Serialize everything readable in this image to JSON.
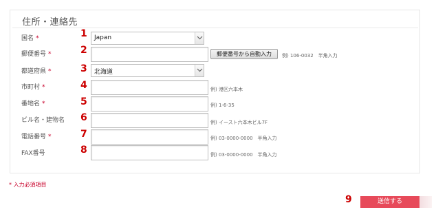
{
  "section_title": "住所・連絡先",
  "required_mark": "*",
  "fields": [
    {
      "label": "国名",
      "required": true,
      "num": "1"
    },
    {
      "label": "郵便番号",
      "required": true,
      "num": "2"
    },
    {
      "label": "都道府県",
      "required": true,
      "num": "3"
    },
    {
      "label": "市町村",
      "required": true,
      "num": "4"
    },
    {
      "label": "番地名",
      "required": true,
      "num": "5"
    },
    {
      "label": "ビル名・建物名",
      "required": false,
      "num": "6"
    },
    {
      "label": "電話番号",
      "required": true,
      "num": "7"
    },
    {
      "label": "FAX番号",
      "required": false,
      "num": "8"
    }
  ],
  "country_select": {
    "value": "Japan"
  },
  "prefecture_select": {
    "value": "北海道"
  },
  "zip_button": "郵便番号から自動入力",
  "hints": {
    "zip": "例) 106-0032　半角入力",
    "city": "例) 港区六本木",
    "address": "例) 1-6-35",
    "building": "例) イースト六本木ビル7F",
    "phone": "例) 03-0000-0000　半角入力",
    "fax": "例) 03-0000-0000　半角入力"
  },
  "required_note": "* 入力必須項目",
  "submit": {
    "label": "送信する",
    "num": "9"
  },
  "colors": {
    "required": "#c8002a",
    "number": "#cc0000",
    "submit": "#e74a5a"
  }
}
